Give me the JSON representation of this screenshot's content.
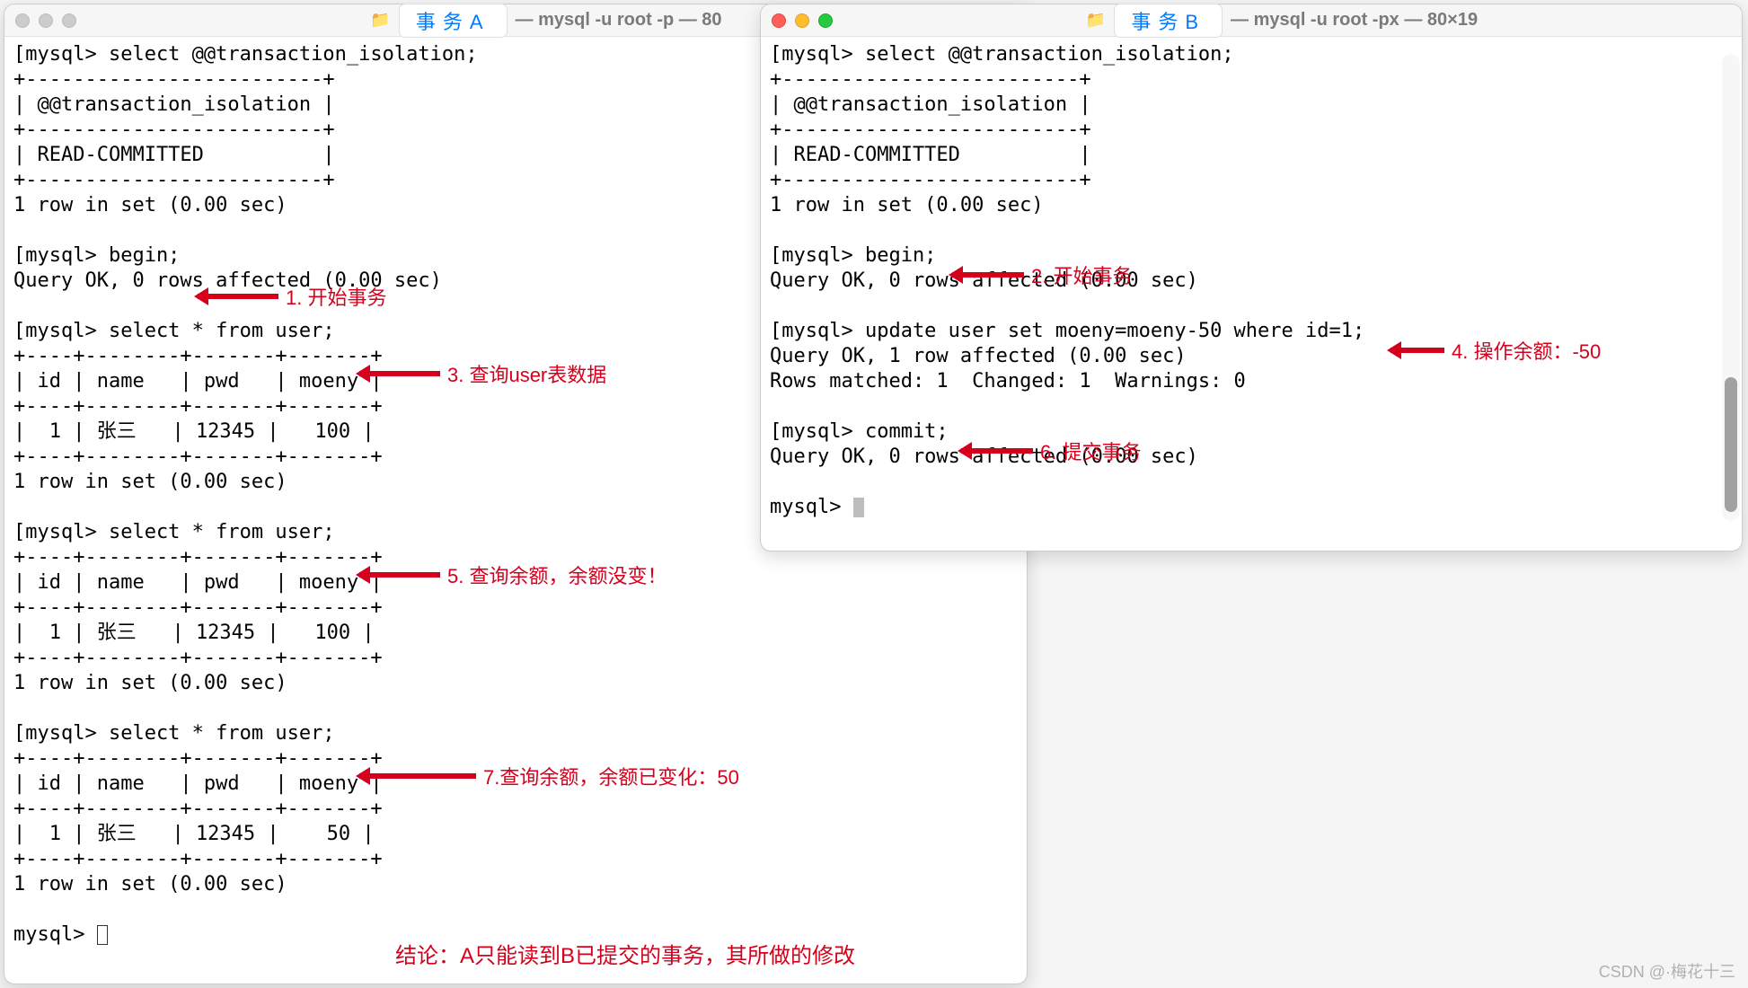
{
  "watermark": "CSDN @·梅花十三",
  "conclusion": "结论：A只能读到B已提交的事务，其所做的修改",
  "windowA": {
    "tab": "事务A",
    "title_rest": "— mysql -u root -p — 80",
    "body": "[mysql> select @@transaction_isolation;\n+-------------------------+\n| @@transaction_isolation |\n+-------------------------+\n| READ-COMMITTED          |\n+-------------------------+\n1 row in set (0.00 sec)\n\n[mysql> begin;\nQuery OK, 0 rows affected (0.00 sec)\n\n[mysql> select * from user;\n+----+--------+-------+-------+\n| id | name   | pwd   | moeny |\n+----+--------+-------+-------+\n|  1 | 张三   | 12345 |   100 |\n+----+--------+-------+-------+\n1 row in set (0.00 sec)\n\n[mysql> select * from user;\n+----+--------+-------+-------+\n| id | name   | pwd   | moeny |\n+----+--------+-------+-------+\n|  1 | 张三   | 12345 |   100 |\n+----+--------+-------+-------+\n1 row in set (0.00 sec)\n\n[mysql> select * from user;\n+----+--------+-------+-------+\n| id | name   | pwd   | moeny |\n+----+--------+-------+-------+\n|  1 | 张三   | 12345 |    50 |\n+----+--------+-------+-------+\n1 row in set (0.00 sec)\n\nmysql> "
  },
  "windowB": {
    "tab": "事务B",
    "title_rest": "— mysql -u root -px — 80×19",
    "body": "[mysql> select @@transaction_isolation;\n+-------------------------+\n| @@transaction_isolation |\n+-------------------------+\n| READ-COMMITTED          |\n+-------------------------+\n1 row in set (0.00 sec)\n\n[mysql> begin;\nQuery OK, 0 rows affected (0.00 sec)\n\n[mysql> update user set moeny=moeny-50 where id=1;\nQuery OK, 1 row affected (0.00 sec)\nRows matched: 1  Changed: 1  Warnings: 0\n\n[mysql> commit;\nQuery OK, 0 rows affected (0.00 sec)\n\nmysql> "
  },
  "annotations": {
    "a1": "1. 开始事务",
    "a3": "3. 查询user表数据",
    "a5": "5. 查询余额，余额没变！",
    "a7": "7.查询余额，余额已变化：50",
    "b2": "2. 开始事务",
    "b4": "4. 操作余额：-50",
    "b6": "6. 提交事务"
  }
}
